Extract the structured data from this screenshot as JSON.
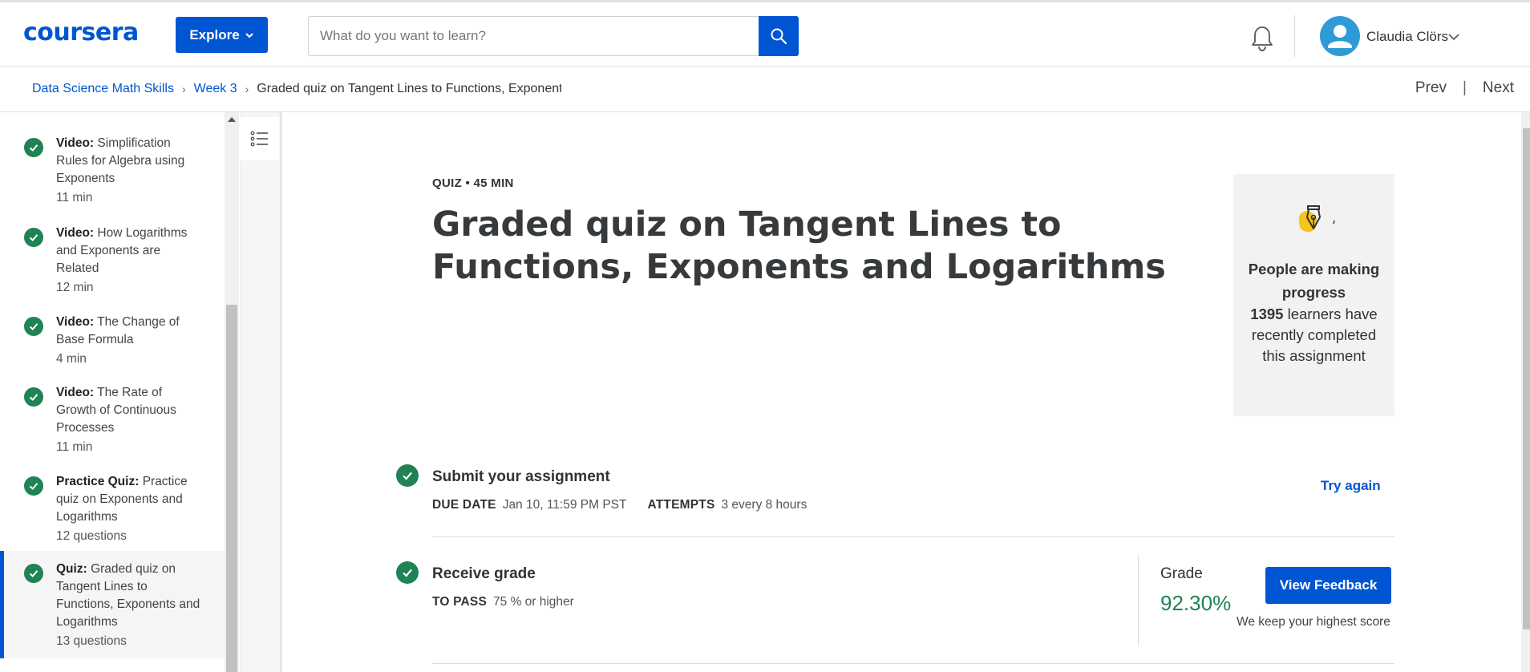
{
  "header": {
    "logo": "coursera",
    "explore_label": "Explore",
    "search_placeholder": "What do you want to learn?",
    "user_name": "Claudia Clörs",
    "icons": [
      "search-icon",
      "bell-icon",
      "avatar-icon",
      "chevron-down-icon"
    ],
    "brand_color": "#0056d2"
  },
  "breadcrumb": {
    "items": [
      "Data Science Math Skills",
      "Week 3"
    ],
    "current": "Graded quiz on Tangent Lines to Functions, Exponent:",
    "prev": "Prev",
    "next": "Next"
  },
  "sidebar": {
    "items": [
      {
        "type": "Video:",
        "title": "Simplification Rules for Algebra using Exponents",
        "meta": "11 min"
      },
      {
        "type": "Video:",
        "title": "How Logarithms and Exponents are Related",
        "meta": "12 min"
      },
      {
        "type": "Video:",
        "title": "The Change of Base Formula",
        "meta": "4 min"
      },
      {
        "type": "Video:",
        "title": "The Rate of Growth of Continuous Processes",
        "meta": "11 min"
      },
      {
        "type": "Practice Quiz:",
        "title": "Practice quiz on Exponents and Logarithms",
        "meta": "12 questions"
      },
      {
        "type": "Quiz:",
        "title": "Graded quiz on Tangent Lines to Functions, Exponents and Logarithms",
        "meta": "13 questions",
        "active": true
      }
    ],
    "status_color": "#1f8354"
  },
  "main": {
    "quiz_type": "QUIZ • 45 MIN",
    "title": "Graded quiz on Tangent Lines to Functions, Exponents and Logarithms",
    "progress": {
      "heading": "People are making progress",
      "count": "1395",
      "suffix": "learners have recently completed this assignment"
    },
    "submit": {
      "title": "Submit your assignment",
      "due_label": "DUE DATE",
      "due_value": "Jan 10, 11:59 PM PST",
      "attempts_label": "ATTEMPTS",
      "attempts_value": "3 every 8 hours",
      "action": "Try again"
    },
    "receive": {
      "title": "Receive grade",
      "pass_label": "TO PASS",
      "pass_value": "75 % or higher",
      "grade_label": "Grade",
      "grade_value": "92.30%",
      "feedback_button": "View Feedback",
      "note": "We keep your highest score"
    }
  }
}
